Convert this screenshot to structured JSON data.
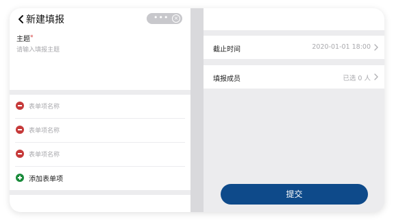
{
  "header": {
    "title": "新建填报",
    "menu_dots": "•••",
    "close_glyph": "×"
  },
  "form": {
    "topic_label": "主题",
    "required_mark": "*",
    "topic_placeholder": "请输入填报主题",
    "items": [
      {
        "label": "表单项名称"
      },
      {
        "label": "表单项名称"
      },
      {
        "label": "表单项名称"
      }
    ],
    "add_label": "添加表单项"
  },
  "settings": {
    "deadline_label": "截止时间",
    "deadline_value": "2020-01-01 18:00",
    "members_label": "填报成员",
    "members_value": "已选 0 人"
  },
  "submit_label": "提交",
  "colors": {
    "primary": "#0e4a8a",
    "remove": "#c63a3a",
    "add": "#1a8b3b",
    "placeholder": "#a9a9ad",
    "background": "#ececee"
  }
}
